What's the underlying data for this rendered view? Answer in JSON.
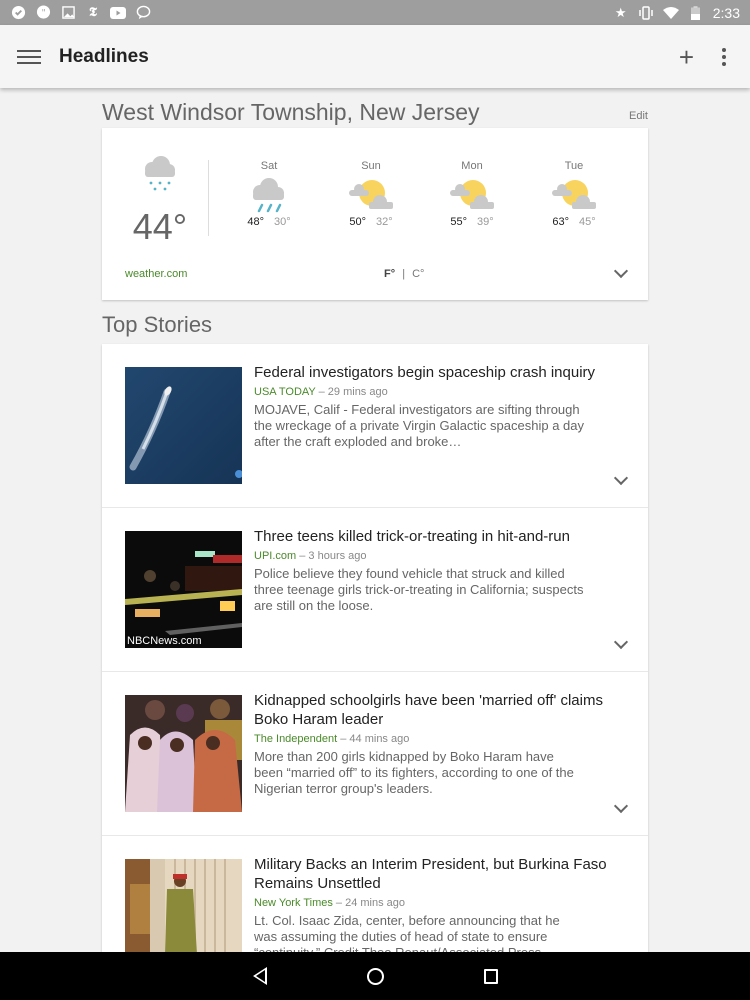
{
  "status_bar": {
    "notification_icons": [
      "hangouts-heart-icon",
      "hangouts-quote-icon",
      "image-icon",
      "nytimes-icon",
      "youtube-icon",
      "chat-bubble-icon"
    ],
    "system_icons": [
      "star-icon",
      "vibrate-icon",
      "wifi-icon",
      "battery-icon"
    ],
    "time": "2:33"
  },
  "app_bar": {
    "title": "Headlines",
    "add_icon": "plus-icon",
    "more_icon": "more-vert-icon"
  },
  "weather": {
    "location": "West Windsor Township, New Jersey",
    "edit_label": "Edit",
    "current": {
      "temp": "44°",
      "condition": "snow-icon"
    },
    "forecast": [
      {
        "day": "Sat",
        "high": "48°",
        "low": "30°",
        "condition": "rain-icon"
      },
      {
        "day": "Sun",
        "high": "50°",
        "low": "32°",
        "condition": "partly-cloudy-icon"
      },
      {
        "day": "Mon",
        "high": "55°",
        "low": "39°",
        "condition": "partly-cloudy-icon"
      },
      {
        "day": "Tue",
        "high": "63°",
        "low": "45°",
        "condition": "partly-cloudy-icon"
      }
    ],
    "source": "weather.com",
    "unit_f": "F°",
    "unit_sep": "|",
    "unit_c": "C°"
  },
  "top_stories": {
    "title": "Top Stories",
    "items": [
      {
        "headline": "Federal investigators begin spaceship crash inquiry",
        "source": "USA TODAY",
        "time": " – 29 mins ago",
        "snippet": "MOJAVE, Calif - Federal investigators are sifting through the wreckage of a private Virgin Galactic spaceship a day after the craft exploded and broke…",
        "thumb_caption": ""
      },
      {
        "headline": "Three teens killed trick-or-treating in hit-and-run",
        "source": "UPI.com",
        "time": " – 3 hours ago",
        "snippet": "Police believe they found vehicle that struck and killed three teenage girls trick-or-treating in California; suspects are still on the loose.",
        "thumb_caption": "NBCNews.com"
      },
      {
        "headline": "Kidnapped schoolgirls have been 'married off' claims Boko Haram leader",
        "source": "The Independent",
        "time": " – 44 mins ago",
        "snippet": "More than 200 girls kidnapped by Boko Haram have been “married off” to its fighters, according to one of the Nigerian terror group's leaders.",
        "thumb_caption": ""
      },
      {
        "headline": "Military Backs an Interim President, but Burkina Faso Remains Unsettled",
        "source": "New York Times",
        "time": " – 24 mins ago",
        "snippet": "Lt. Col. Isaac Zida, center, before announcing that he was assuming the duties of head of state to ensure “continuity.” Credit Theo Renaut/Associated Press",
        "thumb_caption": ""
      }
    ]
  },
  "nav_bar": {
    "back": "back-icon",
    "home": "home-icon",
    "recents": "recents-icon"
  }
}
